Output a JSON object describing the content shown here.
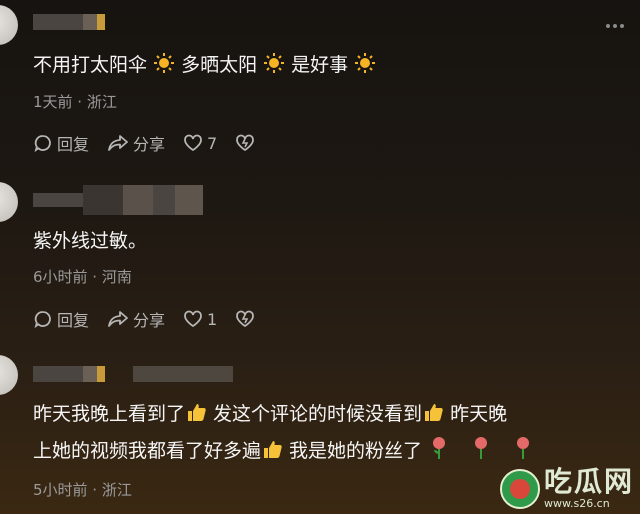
{
  "comments": [
    {
      "text_parts": [
        "不用打太阳伞 ",
        " 多晒太阳 ",
        " 是好事 "
      ],
      "meta": "1天前 · 浙江",
      "reply_label": "回复",
      "share_label": "分享",
      "like_count": "7"
    },
    {
      "text": "紫外线过敏。",
      "meta": "6小时前 · 河南",
      "reply_label": "回复",
      "share_label": "分享",
      "like_count": "1"
    },
    {
      "line1_parts": [
        "昨天我晚上看到了",
        " 发这个评论的时候没看到",
        " 昨天晚"
      ],
      "line2_parts": [
        "上她的视频我都看了好多遍",
        " 我是她的粉丝了"
      ],
      "meta": "5小时前 · 浙江"
    }
  ],
  "watermark": {
    "title": "吃瓜网",
    "url": "www.s26.cn"
  },
  "colors": {
    "background_top": "#161310",
    "background_bottom": "#3a2812",
    "text": "#f5f5f5",
    "meta": "#9a9a9a",
    "sun_emoji": "#f6b323",
    "thumbs_emoji": "#f5c23a"
  },
  "icons": [
    "more-icon",
    "reply-icon",
    "share-icon",
    "like-icon",
    "dislike-icon",
    "sun-emoji",
    "thumbs-up-emoji",
    "rose-emoji"
  ]
}
